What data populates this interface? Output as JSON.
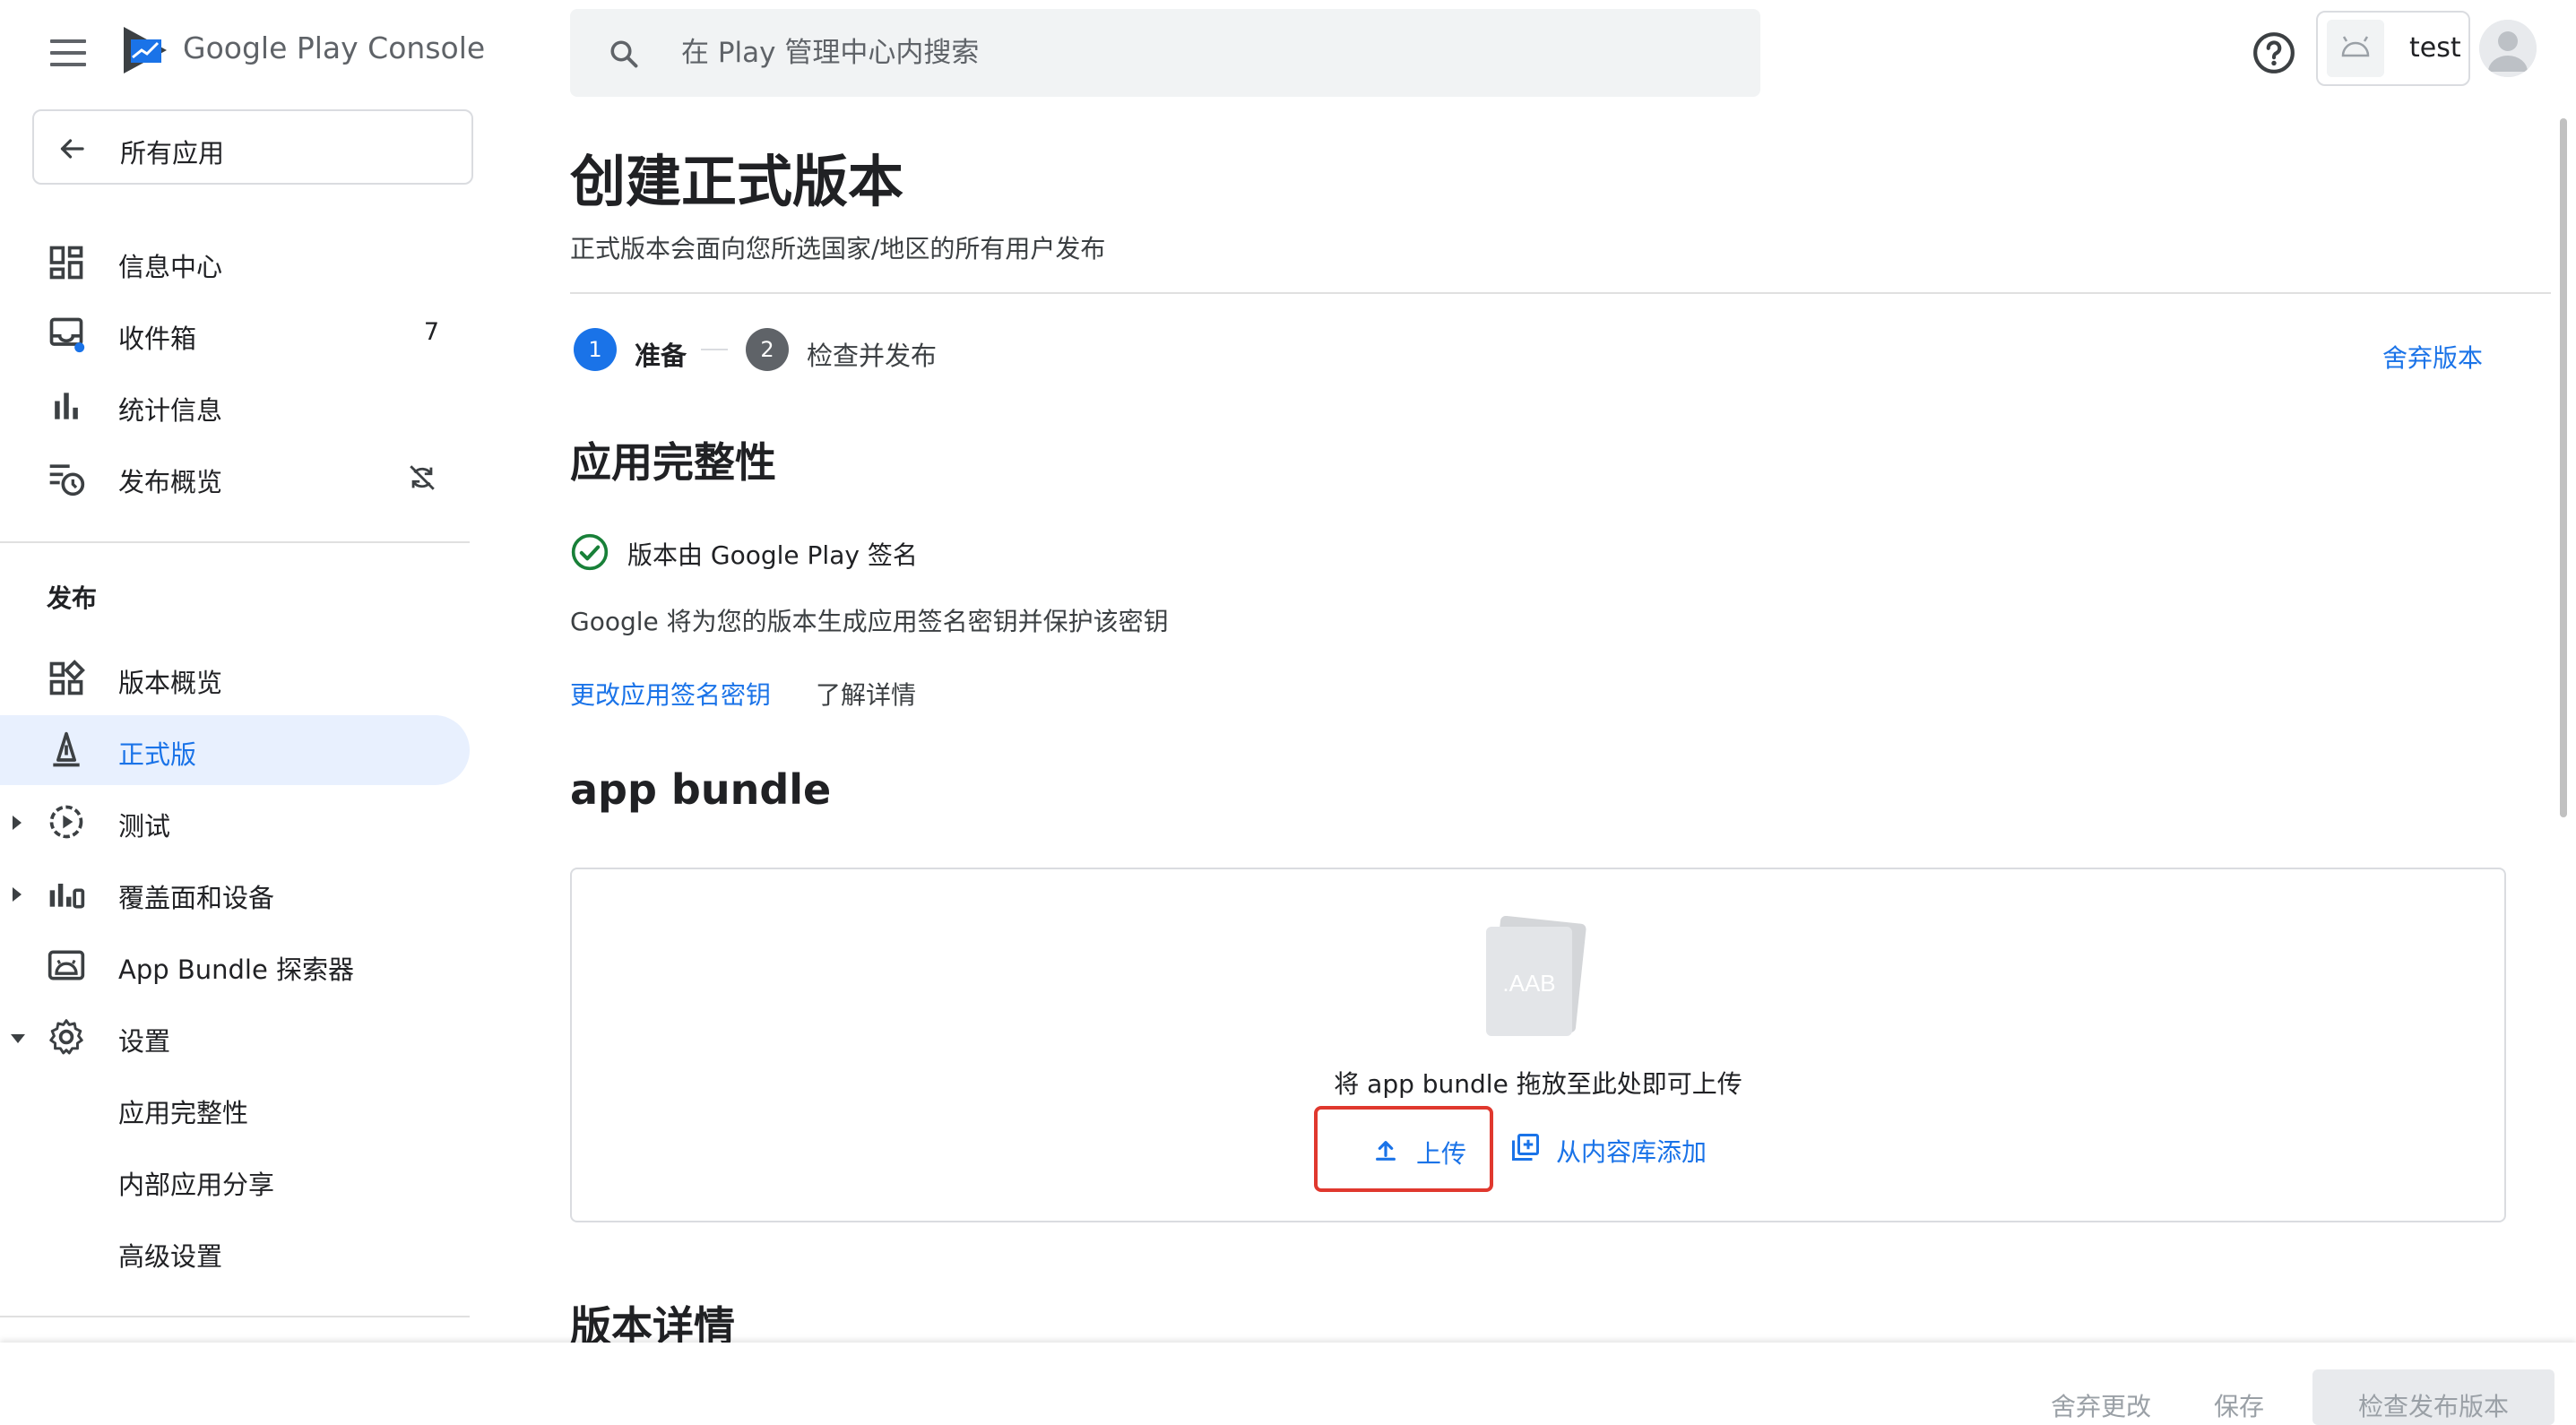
{
  "header": {
    "product_name": "Google Play Console",
    "search_placeholder": "在 Play 管理中心内搜索",
    "account_name": "test"
  },
  "sidebar": {
    "back_label": "所有应用",
    "items": [
      {
        "label": "信息中心"
      },
      {
        "label": "收件箱",
        "badge": "7"
      },
      {
        "label": "统计信息"
      },
      {
        "label": "发布概览"
      }
    ],
    "section_title": "发布",
    "release_items": [
      {
        "label": "版本概览"
      },
      {
        "label": "正式版",
        "active": true
      },
      {
        "label": "测试"
      },
      {
        "label": "覆盖面和设备"
      },
      {
        "label": "App Bundle 探索器"
      },
      {
        "label": "设置"
      }
    ],
    "settings_sub": [
      {
        "label": "应用完整性"
      },
      {
        "label": "内部应用分享"
      },
      {
        "label": "高级设置"
      }
    ]
  },
  "main": {
    "title": "创建正式版本",
    "subtitle": "正式版本会面向您所选国家/地区的所有用户发布",
    "steps": [
      {
        "num": "1",
        "label": "准备"
      },
      {
        "num": "2",
        "label": "检查并发布"
      }
    ],
    "discard_release": "舍弃版本",
    "integrity": {
      "heading": "应用完整性",
      "status": "版本由 Google Play 签名",
      "description": "Google 将为您的版本生成应用签名密钥并保护该密钥",
      "change_link": "更改应用签名密钥",
      "learn_link": "了解详情"
    },
    "bundle": {
      "heading": "app bundle",
      "file_label": ".AAB",
      "drop_text": "将 app bundle 拖放至此处即可上传",
      "upload_label": "上传",
      "library_label": "从内容库添加"
    },
    "details_heading": "版本详情"
  },
  "footer": {
    "discard_changes": "舍弃更改",
    "save": "保存",
    "review": "检查发布版本"
  },
  "colors": {
    "accent": "#1a73e8",
    "active_bg": "#e8f0fe",
    "success": "#188038",
    "highlight_border": "#e0382e",
    "step_inactive": "#5f6368"
  }
}
